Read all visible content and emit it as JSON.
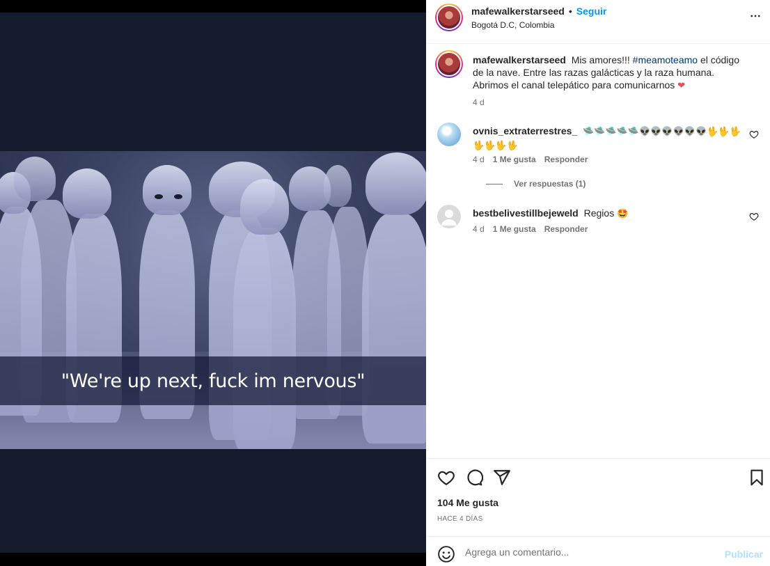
{
  "post": {
    "image_caption": "\"We're up next, fuck im nervous\""
  },
  "header": {
    "username": "mafewalkerstarseed",
    "separator": "•",
    "follow_label": "Seguir",
    "location": "Bogotá D.C, Colombia",
    "more_icon": "more-horizontal-icon"
  },
  "caption": {
    "username": "mafewalkerstarseed",
    "text_before": "Mis amores!!! ",
    "hashtag": "#meamoteamo",
    "text_after": " el código de la nave. Entre las razas galácticas y la raza humana. Abrimos el canal telepático para comunicarnos",
    "emoji": "❤",
    "time": "4 d"
  },
  "comments": [
    {
      "username": "ovnis_extraterrestres_",
      "text": "🛸🛸🛸🛸🛸👽👽👽👽👽👽🖖🖖🖖🖖🖖🖖🖖",
      "time": "4 d",
      "likes": "1 Me gusta",
      "reply": "Responder",
      "view_replies": "Ver respuestas (1)"
    },
    {
      "username": "bestbelivestillbejeweld",
      "text": "Regios",
      "emoji": "🤩",
      "time": "4 d",
      "likes": "1 Me gusta",
      "reply": "Responder"
    }
  ],
  "actions": {
    "like_count": "104 Me gusta",
    "posted": "HACE 4 DÍAS"
  },
  "composer": {
    "placeholder": "Agrega un comentario...",
    "publish_label": "Publicar"
  },
  "colors": {
    "accent": "#0095f6",
    "publish_disabled": "#b2dffc",
    "heart": "#ed4956",
    "media_bg": "#141b2d"
  }
}
